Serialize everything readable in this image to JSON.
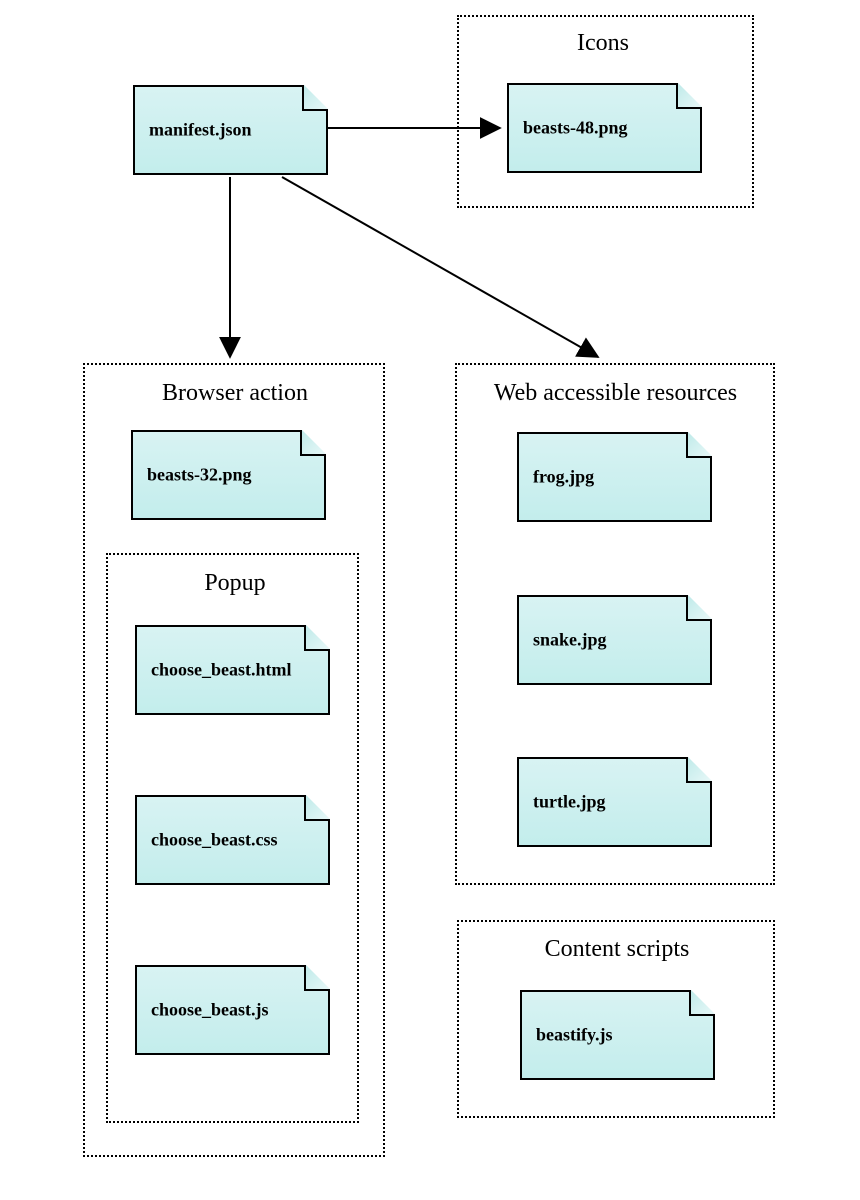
{
  "root": {
    "label": "manifest.json"
  },
  "icons": {
    "title": "Icons",
    "files": [
      {
        "label": "beasts-48.png"
      }
    ]
  },
  "browser_action": {
    "title": "Browser action",
    "files": [
      {
        "label": "beasts-32.png"
      }
    ],
    "popup": {
      "title": "Popup",
      "files": [
        {
          "label": "choose_beast.html"
        },
        {
          "label": "choose_beast.css"
        },
        {
          "label": "choose_beast.js"
        }
      ]
    }
  },
  "war": {
    "title": "Web accessible resources",
    "files": [
      {
        "label": "frog.jpg"
      },
      {
        "label": "snake.jpg"
      },
      {
        "label": "turtle.jpg"
      }
    ]
  },
  "content_scripts": {
    "title": "Content scripts",
    "files": [
      {
        "label": "beastify.js"
      }
    ]
  }
}
